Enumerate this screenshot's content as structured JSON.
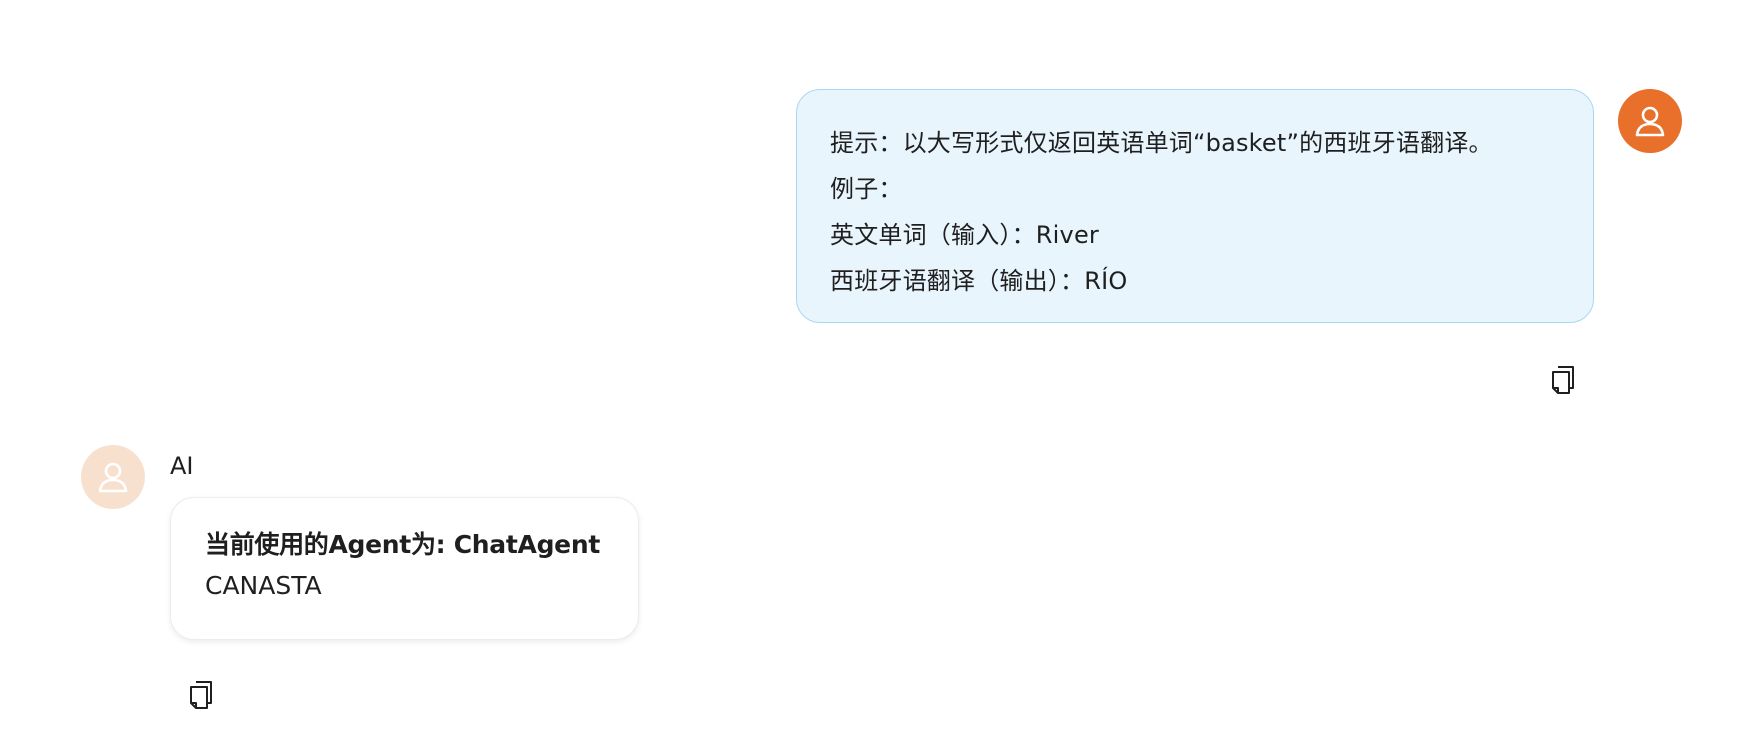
{
  "user_message": {
    "lines": [
      "提示：以大写形式仅返回英语单词“basket”的西班牙语翻译。",
      "例子：",
      "英文单词（输入）：River",
      "西班牙语翻译（输出）：RÍO"
    ],
    "avatar_icon": "user-icon",
    "avatar_color": "#e8702a",
    "bubble_color": "#e8f5fd",
    "copy_icon": "copy-icon"
  },
  "ai_message": {
    "sender_name": "AI",
    "agent_line": "当前使用的Agent为: ChatAgent",
    "reply": "CANASTA",
    "avatar_icon": "user-icon",
    "avatar_color": "#f8e0cf",
    "copy_icon": "copy-icon"
  }
}
